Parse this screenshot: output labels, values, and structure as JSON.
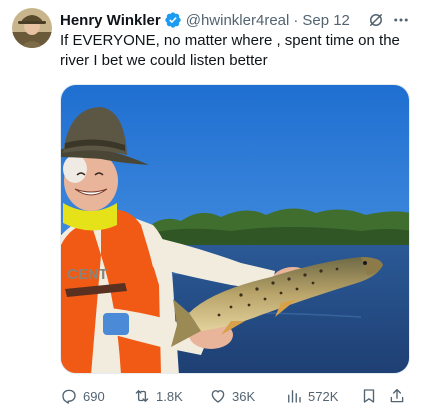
{
  "tweet": {
    "author": {
      "name": "Henry Winkler",
      "handle": "@hwinkler4real",
      "separator": "·",
      "date": "Sep 12",
      "verified_color": "#1d9bf0"
    },
    "text": "If EVERYONE, no matter where , spent time on the river I bet we could listen better",
    "media": {
      "shirt_text": "CENT"
    },
    "metrics": {
      "replies": "690",
      "retweets": "1.8K",
      "likes": "36K",
      "views": "572K"
    },
    "icons": {
      "reply": "reply-icon",
      "retweet": "retweet-icon",
      "like": "heart-icon",
      "views": "views-bar-chart-icon",
      "bookmark": "bookmark-icon",
      "share": "share-icon",
      "more": "more-dots-icon",
      "grok": "grok-icon",
      "verified": "verified-badge-icon"
    },
    "colors": {
      "text_primary": "#0f1419",
      "text_secondary": "#536471",
      "verified": "#1d9bf0"
    }
  }
}
